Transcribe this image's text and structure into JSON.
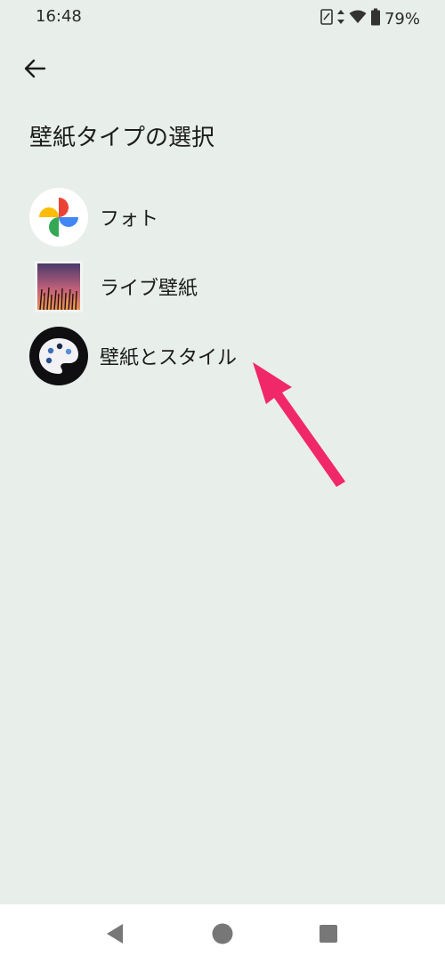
{
  "status_bar": {
    "time": "16:48",
    "battery_percent": "79%",
    "icons": [
      "nfc-icon",
      "data-arrows-icon",
      "wifi-icon",
      "battery-icon"
    ]
  },
  "header": {
    "back_icon": "back-arrow-icon",
    "title": "壁紙タイプの選択"
  },
  "wallpaper_types": [
    {
      "label": "フォト",
      "icon": "google-photos-icon"
    },
    {
      "label": "ライブ壁紙",
      "icon": "live-wallpaper-icon"
    },
    {
      "label": "壁紙とスタイル",
      "icon": "wallpaper-style-palette-icon"
    }
  ],
  "annotation": {
    "icon": "pointer-arrow",
    "color": "#f0286a"
  },
  "nav_bar": {
    "icons": [
      "nav-back-icon",
      "nav-home-icon",
      "nav-recents-icon"
    ]
  },
  "colors": {
    "background": "#e8eeea",
    "nav_background": "#ffffff",
    "annotation_arrow": "#f0286a"
  }
}
